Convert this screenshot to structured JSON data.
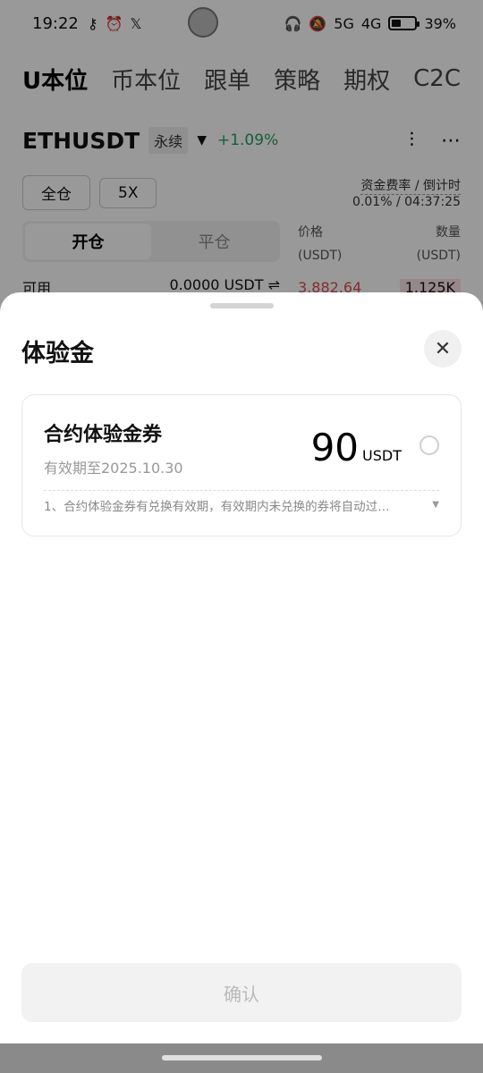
{
  "status_bar": {
    "time": "19:22",
    "left_icons": [
      "key-icon",
      "alarm-icon",
      "x-logo-icon"
    ],
    "network_5g": "5G",
    "network_4g": "4G",
    "battery": "39%"
  },
  "top_nav": {
    "tabs": [
      "U本位",
      "币本位",
      "跟单",
      "策略",
      "期权",
      "C2C"
    ],
    "active_index": 0
  },
  "pair": {
    "name": "ETHUSDT",
    "type_tag": "永续",
    "change": "+1.09%"
  },
  "controls": {
    "margin_mode": "全仓",
    "leverage": "5X",
    "funding_label": "资金费率 / 倒计时",
    "funding_value": "0.01% / 04:37:25"
  },
  "order_tabs": {
    "open": "开仓",
    "close": "平仓"
  },
  "orderbook": {
    "price_label": "价格",
    "price_unit": "(USDT)",
    "qty_label": "数量",
    "qty_unit": "(USDT)",
    "ask_price": "3,882.64",
    "ask_qty": "1.125K"
  },
  "available": {
    "label": "可用",
    "value": "0.0000 USDT ⇌"
  },
  "sheet": {
    "title": "体验金",
    "close_glyph": "✕",
    "card": {
      "title": "合约体验金券",
      "validity": "有效期至2025.10.30",
      "amount": "90",
      "unit": "USDT",
      "terms": "1、合约体验金券有兑换有效期，有效期内未兑换的券将自动过…"
    },
    "confirm_label": "确认"
  }
}
